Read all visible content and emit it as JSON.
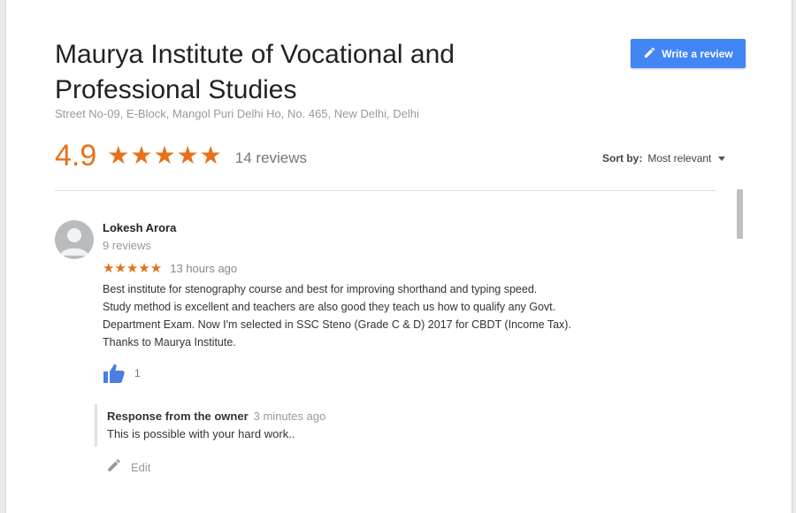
{
  "place": {
    "name": "Maurya Institute of Vocational and Professional Studies",
    "address": "Street No-09, E-Block, Mangol Puri Delhi Ho, No. 465, New Delhi, Delhi"
  },
  "actions": {
    "write_review_label": "Write a review"
  },
  "summary": {
    "rating": "4.9",
    "stars": "★★★★★",
    "reviews_count": "14 reviews"
  },
  "sort": {
    "label": "Sort by:",
    "value": "Most relevant"
  },
  "review": {
    "author": "Lokesh Arora",
    "author_reviews": "9 reviews",
    "stars": "★★★★★",
    "rating": 5,
    "time": "13 hours ago",
    "text": "Best institute for stenography course and best for improving shorthand and typing speed.\nStudy method is excellent and teachers are also good they teach us how to qualify any Govt.\nDepartment Exam. Now I'm selected in SSC Steno (Grade C & D) 2017 for CBDT (Income Tax).\nThanks to Maurya Institute.",
    "likes": "1",
    "owner_response": {
      "label": "Response from the owner",
      "time": "3 minutes ago",
      "text": "This is possible with your hard work.."
    },
    "edit_label": "Edit"
  },
  "colors": {
    "accent_orange": "#e7711b",
    "button_blue": "#4285f4",
    "like_blue": "#4a7fe0"
  },
  "icons": [
    "pencil-icon",
    "star-icon",
    "caret-down-icon",
    "avatar-icon",
    "thumbs-up-icon",
    "edit-pencil-icon"
  ]
}
